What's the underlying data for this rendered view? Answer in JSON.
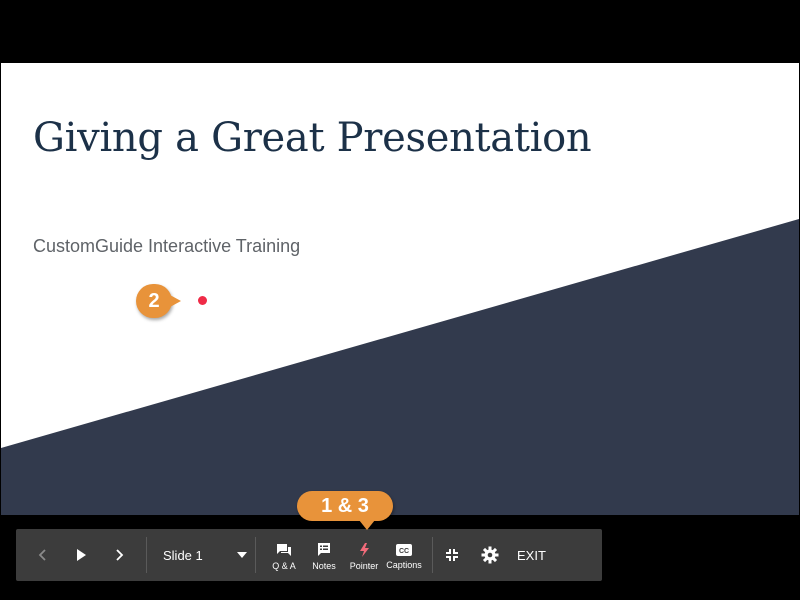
{
  "slide": {
    "title": "Giving a Great Presentation",
    "subtitle": "CustomGuide Interactive Training",
    "colors": {
      "background": "#ffffff",
      "shape": "#323a4d",
      "title": "#1c3148",
      "pointer": "#ef2b47"
    }
  },
  "callouts": {
    "pointer_step": "2",
    "toolbar_steps": "1 & 3",
    "color": "#e8933a"
  },
  "toolbar": {
    "prev_icon": "chevron-left-icon",
    "play_icon": "play-icon",
    "next_icon": "chevron-right-icon",
    "slide_selector": {
      "selected": "Slide 1",
      "icon": "caret-down-icon"
    },
    "qa_label": "Q & A",
    "notes_label": "Notes",
    "pointer_label": "Pointer",
    "captions_label": "Captions",
    "minimize_icon": "exit-fullscreen-icon",
    "settings_icon": "gear-icon",
    "exit_label": "EXIT"
  }
}
